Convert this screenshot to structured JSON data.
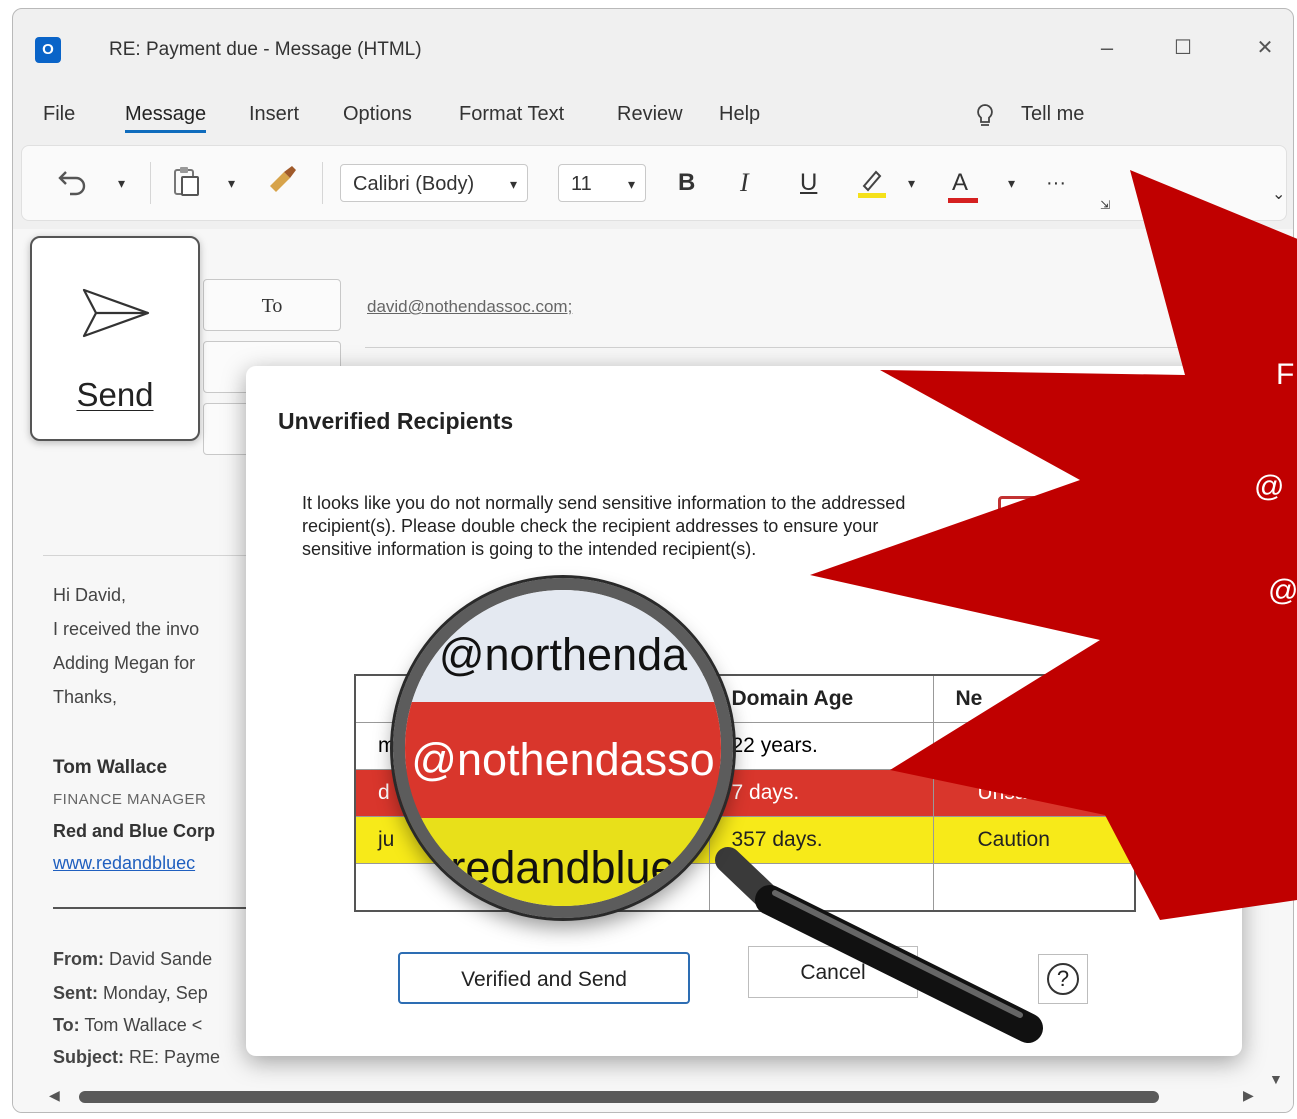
{
  "window": {
    "app_icon": "O",
    "title": "RE: Payment due  -  Message (HTML)",
    "minimize": "–",
    "maximize": "☐",
    "close": "✕"
  },
  "menu": {
    "items": [
      "File",
      "Message",
      "Insert",
      "Options",
      "Format Text",
      "Review",
      "Help"
    ],
    "tell_me": "Tell me"
  },
  "ribbon": {
    "font_name": "Calibri (Body)",
    "font_size": "11",
    "bold": "B",
    "italic": "I",
    "underline": "U",
    "font_color": "A",
    "more": "···"
  },
  "compose": {
    "to_label": "To",
    "to_address": "david@nothendassoc.com;",
    "body": {
      "greeting": "Hi David,",
      "line1": "I received the invo",
      "line2": "Adding Megan for",
      "line3": "Thanks,",
      "sig_name": "Tom Wallace",
      "sig_role": "FINANCE MANAGER",
      "sig_company": "Red and Blue Corp",
      "sig_link": "www.redandbluec"
    },
    "quoted": {
      "from_label": "From:",
      "from_value": "David Sande",
      "sent_label": "Sent:",
      "sent_value": "Monday, Sep",
      "to_label": "To:",
      "to_value": "Tom Wallace <",
      "subject_label": "Subject:",
      "subject_value": "RE: Payme"
    }
  },
  "send_card": {
    "label": "Send"
  },
  "dialog": {
    "title": "Unverified Recipients",
    "message": "It looks like you do not normally send sensitive information to the addressed recipient(s). Please double check the recipient addresses to ensure your sensitive information is going to the intended recipient(s).",
    "table": {
      "headers": [
        "",
        "Domain Age",
        "Ne"
      ],
      "rows": [
        {
          "recipient": "m",
          "age": "22 years.",
          "status": ""
        },
        {
          "recipient": "d",
          "age": "7 days.",
          "status": "Unsafe"
        },
        {
          "recipient": "ju",
          "age": "357 days.",
          "status": "Caution"
        }
      ]
    },
    "verify_button": "Verified and Send",
    "cancel_button": "Cancel",
    "help_button": "?"
  },
  "magnifier": {
    "line1": "@northenda",
    "line2": "@nothendasso",
    "line3": "redandblue"
  },
  "starburst": {
    "texts": [
      "F",
      "@",
      "@"
    ]
  },
  "colors": {
    "unsafe_row": "#d9362c",
    "caution_row": "#f7ea19",
    "starburst": "#c00000",
    "accent": "#0f6cbd"
  }
}
